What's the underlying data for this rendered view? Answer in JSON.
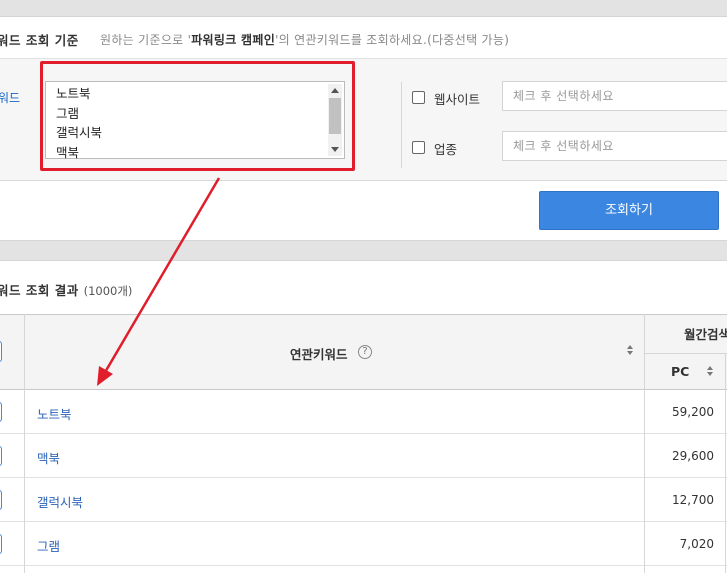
{
  "criteria": {
    "title": "워드 조회 기준",
    "desc_prefix": "원하는 기준으로 '",
    "desc_bold": "파워링크 캠페인",
    "desc_suffix": "'의 연관키워드를 조회하세요.(다중선택 가능)",
    "side_label": "워드",
    "keywords": [
      "노트북",
      "그램",
      "갤럭시북",
      "맥북"
    ],
    "website_label": "웹사이트",
    "website_placeholder": "체크 후 선택하세요",
    "industry_label": "업종",
    "industry_placeholder": "체크 후 선택하세요",
    "search_button": "조회하기"
  },
  "results": {
    "title": "워드 조회 결과",
    "count": "(1000개)",
    "columns": {
      "keyword": "연관키워드",
      "help": "?",
      "monthly": "월간검색",
      "pc": "PC"
    },
    "rows": [
      {
        "keyword": "노트북",
        "pc": "59,200"
      },
      {
        "keyword": "맥북",
        "pc": "29,600"
      },
      {
        "keyword": "갤럭시북",
        "pc": "12,700"
      },
      {
        "keyword": "그램",
        "pc": "7,020"
      }
    ]
  },
  "colors": {
    "accent": "#3b86e0",
    "link": "#2b63b8",
    "highlight": "#e01e2b"
  }
}
